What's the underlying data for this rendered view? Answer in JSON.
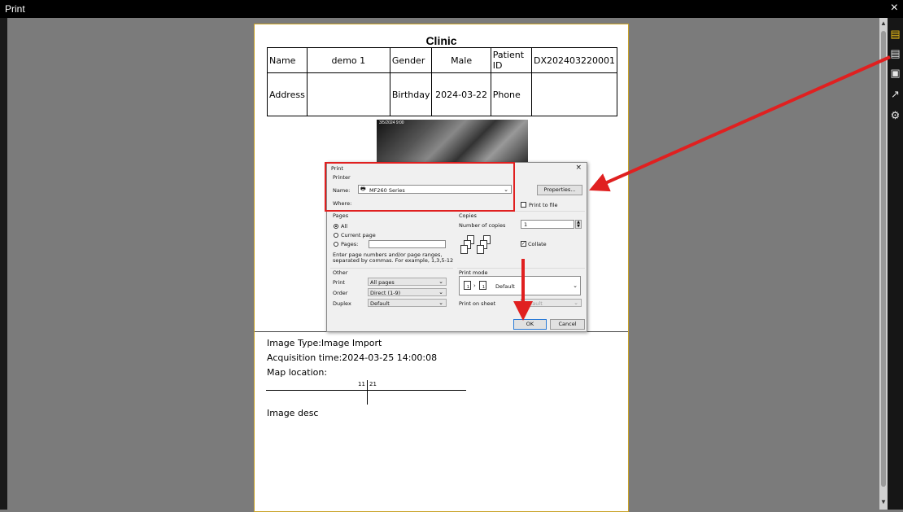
{
  "window": {
    "title": "Print",
    "close_glyph": "×"
  },
  "toolbar_icons": [
    "print-preview-icon",
    "print-icon",
    "save-icon",
    "export-icon",
    "settings-icon"
  ],
  "report": {
    "title": "Clinic",
    "table": {
      "name_label": "Name",
      "name_value": "demo 1",
      "gender_label": "Gender",
      "gender_value": "Male",
      "patient_id_label": "Patient ID",
      "patient_id_value": "DX202403220001",
      "address_label": "Address",
      "address_value": "",
      "birthday_label": "Birthday",
      "birthday_value": "2024-03-22",
      "phone_label": "Phone",
      "phone_value": ""
    },
    "image_label": "3/5/2024 9:00",
    "image_type": "Image Type:Image Import",
    "acquisition_time": "Acquisition time:2024-03-25 14:00:08",
    "map_location": "Map location:",
    "map_left": "11",
    "map_right": "21",
    "image_desc": "Image desc"
  },
  "print_dialog": {
    "title": "Print",
    "close_glyph": "×",
    "printer_group": "Printer",
    "name_label": "Name:",
    "printer_name": "MF260 Series",
    "properties_button": "Properties...",
    "where_label": "Where:",
    "print_to_file": "Print to file",
    "pages_group": "Pages",
    "opt_all": "All",
    "opt_current": "Current page",
    "opt_pages": "Pages:",
    "pages_hint_1": "Enter page numbers and/or page ranges,",
    "pages_hint_2": "separated by commas. For example, 1,3,5-12",
    "copies_group": "Copies",
    "copies_label": "Number of copies",
    "copies_value": "1",
    "collate": "Collate",
    "other_group": "Other",
    "print_label": "Print",
    "print_value": "All pages",
    "order_label": "Order",
    "order_value": "Direct (1-9)",
    "duplex_label": "Duplex",
    "duplex_value": "Default",
    "print_mode_group": "Print mode",
    "print_mode_value": "Default",
    "print_on_sheet_label": "Print on sheet",
    "print_on_sheet_value": "Default",
    "ok_button": "OK",
    "cancel_button": "Cancel"
  },
  "annotation_color": "#e02020"
}
